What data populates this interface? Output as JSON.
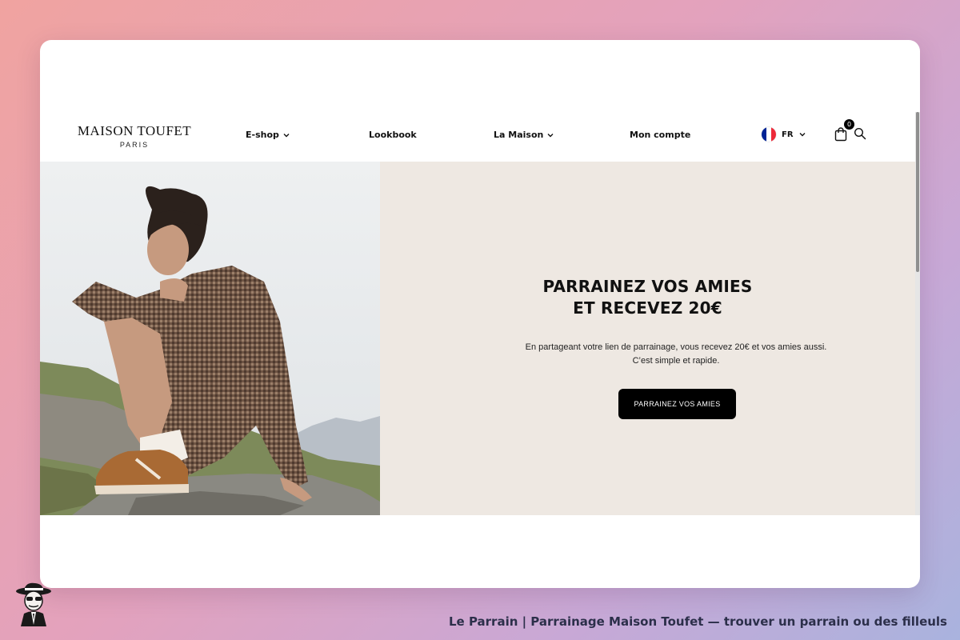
{
  "brand": {
    "name": "MAISON TOUFET",
    "subtitle": "PARIS"
  },
  "nav": {
    "items": [
      {
        "label": "E-shop",
        "has_dropdown": true
      },
      {
        "label": "Lookbook",
        "has_dropdown": false
      },
      {
        "label": "La Maison",
        "has_dropdown": true
      },
      {
        "label": "Mon compte",
        "has_dropdown": false
      }
    ]
  },
  "lang": {
    "code": "FR",
    "flag_colors": [
      "#002395",
      "#ffffff",
      "#ed2939"
    ]
  },
  "cart": {
    "count": "0",
    "icon": "shopping-bag-icon"
  },
  "search": {
    "icon": "search-icon"
  },
  "hero": {
    "title_line1": "PARRAINEZ VOS AMIES",
    "title_line2": "ET RECEVEZ 20€",
    "text": "En partageant votre lien de parrainage, vous recevez 20€ et vos amies aussi. C’est simple et rapide.",
    "button_label": "PARRAINEZ VOS AMIES",
    "panel_color": "#eee8e2"
  },
  "caption": "Le Parrain | Parrainage Maison Toufet — trouver un parrain ou des filleuls"
}
